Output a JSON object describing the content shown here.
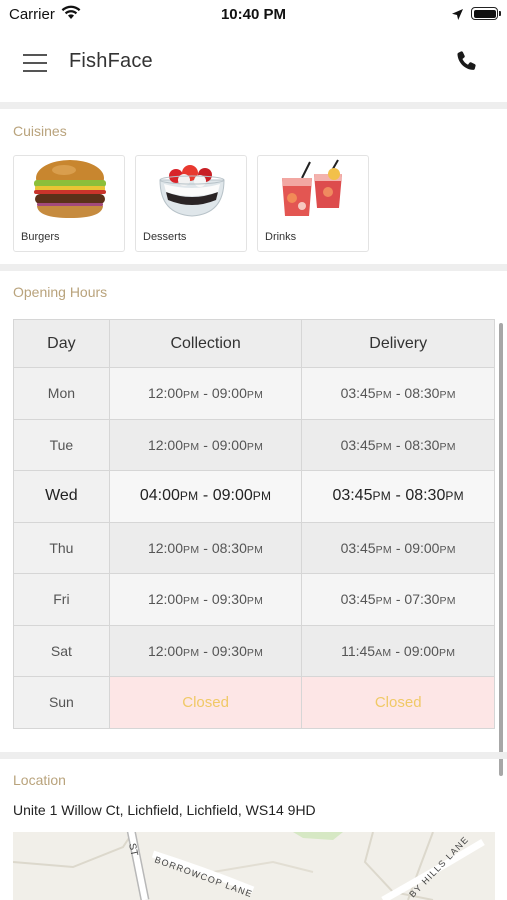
{
  "status_bar": {
    "carrier": "Carrier",
    "time": "10:40 PM"
  },
  "header": {
    "title": "FishFace"
  },
  "cuisines": {
    "label": "Cuisines",
    "items": [
      {
        "name": "Burgers",
        "icon": "burger-icon"
      },
      {
        "name": "Desserts",
        "icon": "dessert-icon"
      },
      {
        "name": "Drinks",
        "icon": "drinks-icon"
      }
    ]
  },
  "opening_hours": {
    "label": "Opening Hours",
    "columns": [
      "Day",
      "Collection",
      "Delivery"
    ],
    "rows": [
      {
        "day": "Mon",
        "collection": [
          "12:00",
          "PM",
          " - ",
          "09:00",
          "PM"
        ],
        "delivery": [
          "03:45",
          "PM",
          " - ",
          "08:30",
          "PM"
        ]
      },
      {
        "day": "Tue",
        "collection": [
          "12:00",
          "PM",
          " - ",
          "09:00",
          "PM"
        ],
        "delivery": [
          "03:45",
          "PM",
          " - ",
          "08:30",
          "PM"
        ]
      },
      {
        "day": "Wed",
        "collection": [
          "04:00",
          "PM",
          " - ",
          "09:00",
          "PM"
        ],
        "delivery": [
          "03:45",
          "PM",
          " - ",
          "08:30",
          "PM"
        ]
      },
      {
        "day": "Thu",
        "collection": [
          "12:00",
          "PM",
          " - ",
          "08:30",
          "PM"
        ],
        "delivery": [
          "03:45",
          "PM",
          " - ",
          "09:00",
          "PM"
        ]
      },
      {
        "day": "Fri",
        "collection": [
          "12:00",
          "PM",
          " - ",
          "09:30",
          "PM"
        ],
        "delivery": [
          "03:45",
          "PM",
          " - ",
          "07:30",
          "PM"
        ]
      },
      {
        "day": "Sat",
        "collection": [
          "12:00",
          "PM",
          " - ",
          "09:30",
          "PM"
        ],
        "delivery": [
          "11:45",
          "AM",
          " - ",
          "09:00",
          "PM"
        ]
      },
      {
        "day": "Sun",
        "collection": [
          "Closed"
        ],
        "delivery": [
          "Closed"
        ]
      }
    ],
    "today": "Wed",
    "closed_text_color": "#f0c966",
    "closed_bg_color": "#fde6e6"
  },
  "location": {
    "label": "Location",
    "address": "Unite 1 Willow Ct, Lichfield, Lichfield, WS14 9HD",
    "map_labels": {
      "road_1": "BORROWCOP LANE",
      "road_2": "ST",
      "road_3": "BY HILLS LANE"
    }
  },
  "colors": {
    "accent_label": "#b9a37c",
    "divider": "#eeeeee"
  }
}
